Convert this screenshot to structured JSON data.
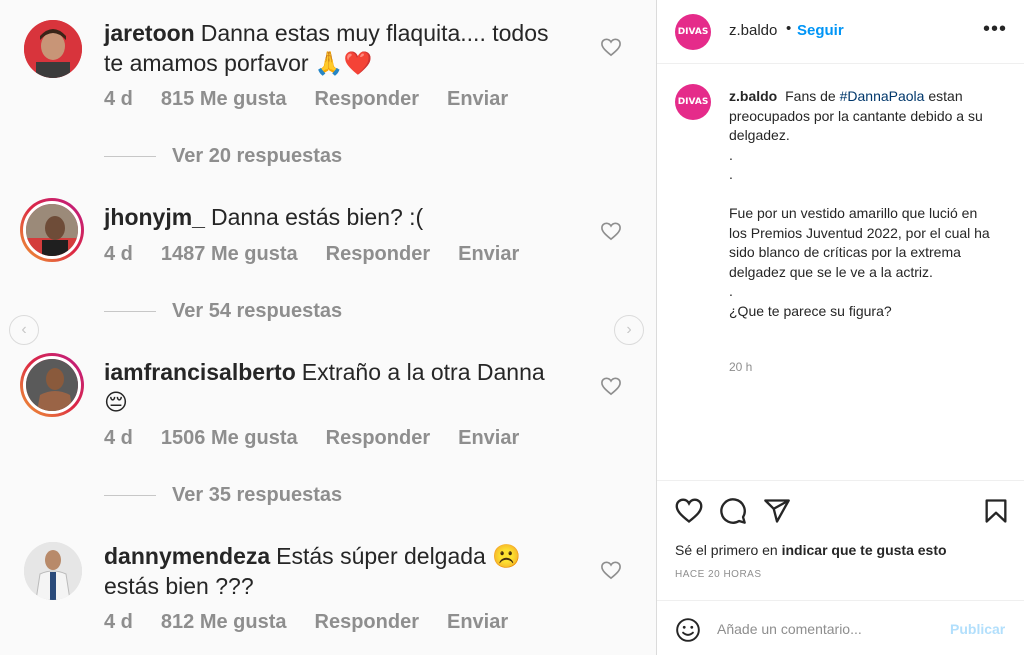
{
  "comments": [
    {
      "username": "jaretoon",
      "text": "Danna estas muy flaquita.... todos te amamos porfavor 🙏❤️",
      "time": "4 d",
      "likes": "815 Me gusta",
      "reply": "Responder",
      "send": "Enviar",
      "replies": "Ver 20 respuestas"
    },
    {
      "username": "jhonyjm_",
      "text": "Danna estás bien? :(",
      "time": "4 d",
      "likes": "1487 Me gusta",
      "reply": "Responder",
      "send": "Enviar",
      "replies": "Ver 54 respuestas"
    },
    {
      "username": "iamfrancisalberto",
      "text": "Extraño a la otra Danna 😔",
      "time": "4 d",
      "likes": "1506 Me gusta",
      "reply": "Responder",
      "send": "Enviar",
      "replies": "Ver 35 respuestas"
    },
    {
      "username": "dannymendeza",
      "text": "Estás súper delgada ☹️ estás bien ???",
      "time": "4 d",
      "likes": "812 Me gusta",
      "reply": "Responder",
      "send": "Enviar"
    }
  ],
  "post": {
    "username": "z.baldo",
    "separator": "•",
    "follow": "Seguir",
    "more": "•••",
    "logo_text": "DIVAS",
    "caption_user": "z.baldo",
    "caption_pre": "Fans de",
    "hashtag": "#DannaPaola",
    "caption_post": "estan preocupados por la cantante debido a su delgadez.",
    "dot1": ".",
    "dot2": ".",
    "body": "Fue por un vestido amarillo que lució en los Premios Juventud 2022, por el cual ha sido blanco de críticas por la extrema delgadez que se le ve a la actriz.",
    "dot3": ".",
    "question": "¿Que te parece su figura?",
    "time": "20 h",
    "likes_pre": "Sé el primero en",
    "likes_bold": "indicar que te gusta esto",
    "ago": "HACE 20 HORAS",
    "add_comment": "Añade un comentario...",
    "publish": "Publicar"
  },
  "colors": {
    "accent": "#0095f6",
    "muted": "#8e8e8e",
    "hashtag": "#00376b"
  },
  "icons": [
    "heart-icon",
    "comment-icon",
    "share-icon",
    "bookmark-icon",
    "emoji-icon",
    "chevron-left-icon",
    "chevron-right-icon",
    "more-icon"
  ]
}
